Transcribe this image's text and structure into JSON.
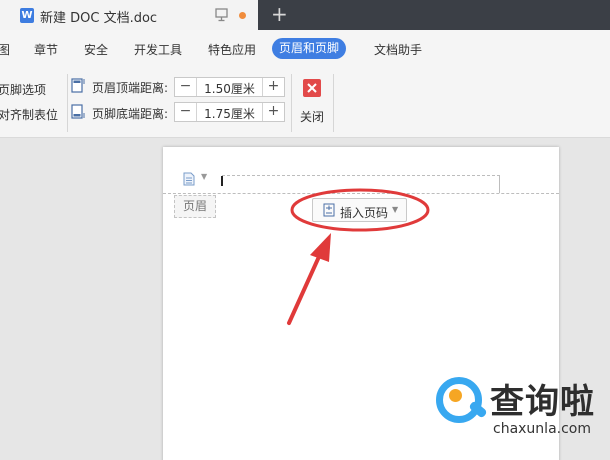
{
  "tabbar": {
    "doc_icon_letter": "W",
    "doc_title": "新建 DOC 文档.doc",
    "new_tab_symbol": "+"
  },
  "menu": {
    "items": [
      "图",
      "章节",
      "安全",
      "开发工具",
      "特色应用",
      "页眉和页脚",
      "文档助手"
    ],
    "active": "页眉和页脚"
  },
  "toolbar": {
    "footer_options": "页脚选项",
    "align_tab": "对齐制表位",
    "header_top_label": "页眉顶端距离:",
    "header_top_value": "1.50厘米",
    "footer_bottom_label": "页脚底端距离:",
    "footer_bottom_value": "1.75厘米",
    "minus_symbol": "−",
    "plus_symbol": "+",
    "close_label": "关闭"
  },
  "page": {
    "header_tag": "页眉",
    "insert_page_number": "插入页码"
  },
  "watermark": {
    "title": "查询啦",
    "url": "chaxunla.com"
  },
  "colors": {
    "accent": "#3f7ee2",
    "annotation_red": "#e03a3a",
    "close_red": "#e24a4a",
    "watermark_blue": "#38a8f0",
    "watermark_orange": "#f6a623"
  }
}
